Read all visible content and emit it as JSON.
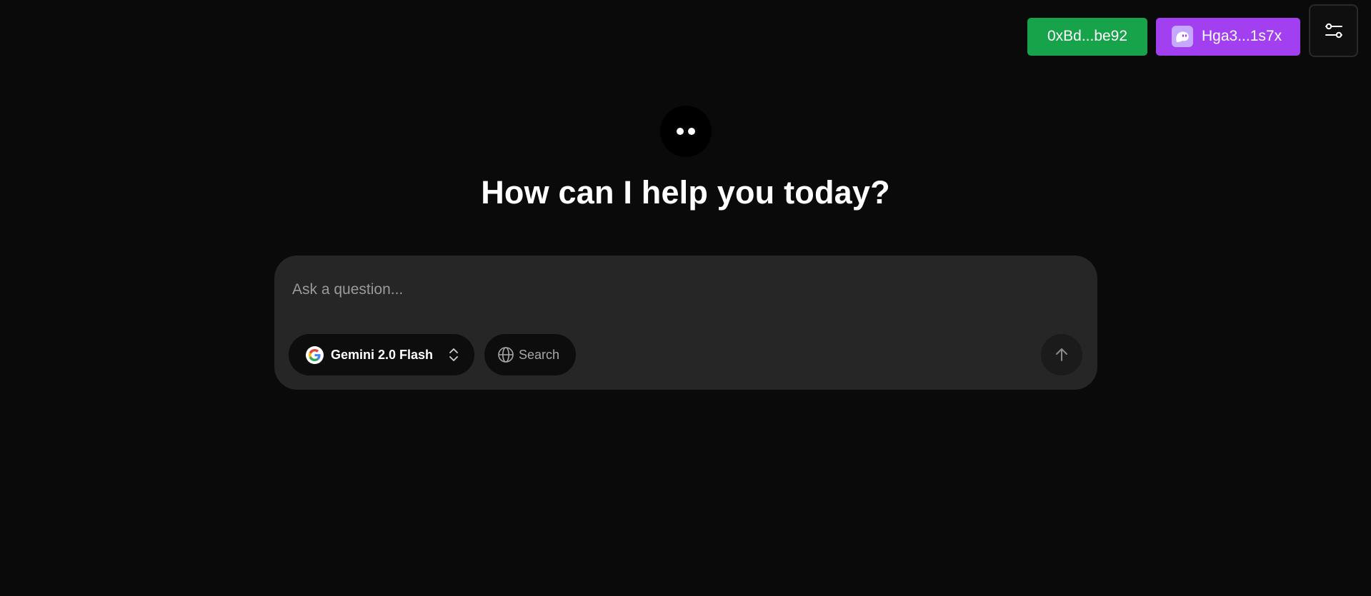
{
  "header": {
    "eth_wallet_label": "0xBd...be92",
    "sol_wallet_label": "Hga3...1s7x",
    "settings_icon": "sliders-icon"
  },
  "hero": {
    "avatar_icon": "two-dots-logo-icon",
    "title": "How can I help you today?"
  },
  "composer": {
    "placeholder": "Ask a question...",
    "value": "",
    "model": {
      "provider_icon": "google-g-icon",
      "selected": "Gemini 2.0 Flash",
      "chevron_icon": "chevron-up-down-icon"
    },
    "search": {
      "icon": "globe-icon",
      "label": "Search"
    },
    "send_icon": "arrow-up-icon"
  },
  "colors": {
    "background": "#0a0a0a",
    "composer": "#262626",
    "eth_wallet": "#16a34a",
    "sol_wallet": "#a23ff0"
  }
}
